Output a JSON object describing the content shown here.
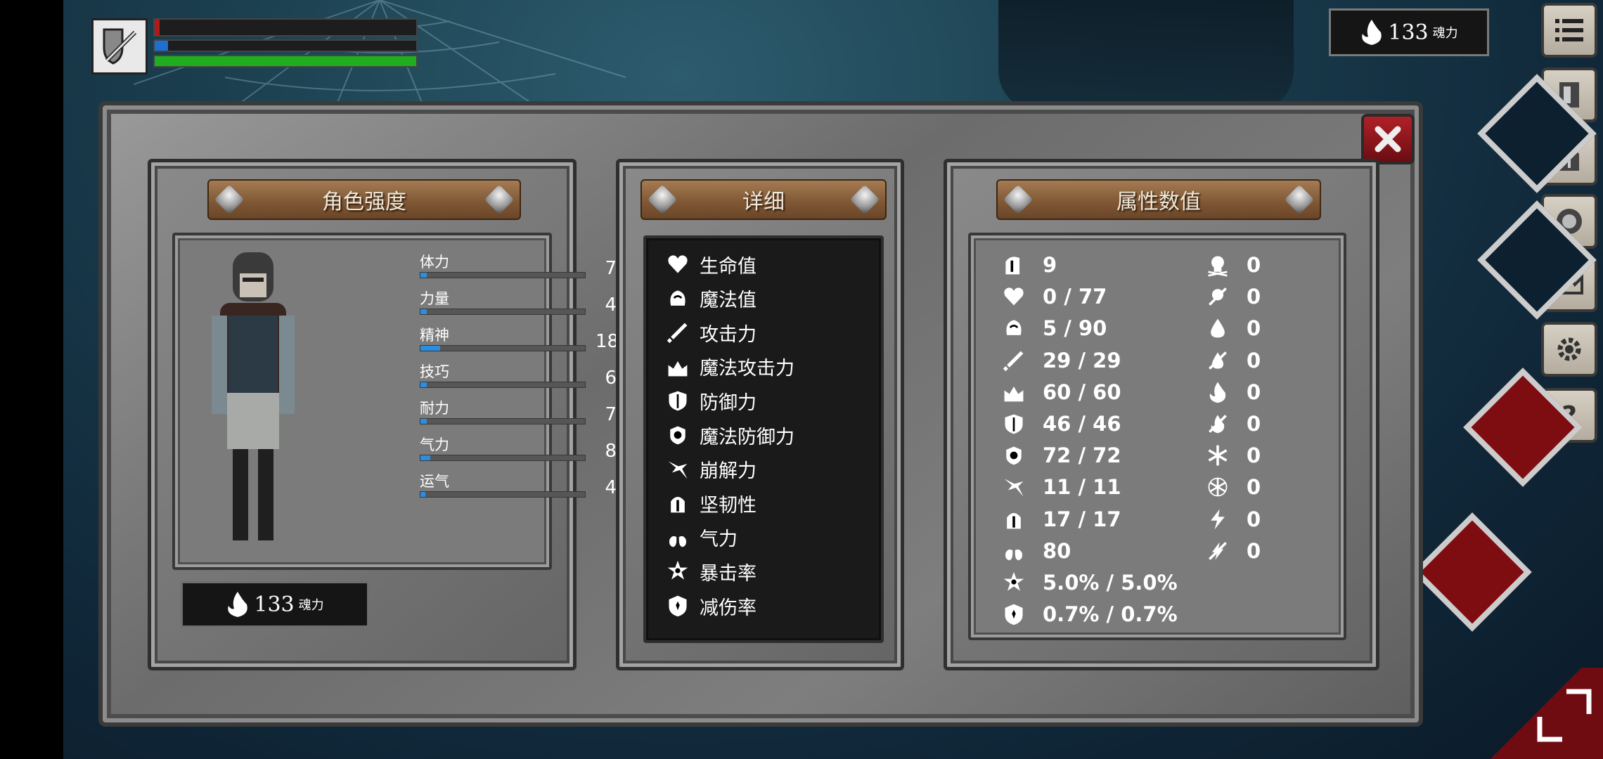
{
  "hud": {
    "soul_value": "133",
    "soul_label": "魂力"
  },
  "panels": {
    "character": {
      "title": "角色强度",
      "stats": [
        {
          "label": "体力",
          "value": "7",
          "fill": 0.04
        },
        {
          "label": "力量",
          "value": "4",
          "fill": 0.04
        },
        {
          "label": "精神",
          "value": "18",
          "fill": 0.12
        },
        {
          "label": "技巧",
          "value": "6",
          "fill": 0.04
        },
        {
          "label": "耐力",
          "value": "7",
          "fill": 0.04
        },
        {
          "label": "气力",
          "value": "8",
          "fill": 0.06
        },
        {
          "label": "运气",
          "value": "4",
          "fill": 0.03
        }
      ],
      "soul_value": "133",
      "soul_label": "魂力"
    },
    "detail": {
      "title": "详细",
      "items": [
        {
          "label": "生命值",
          "icon": "heart-icon"
        },
        {
          "label": "魔法值",
          "icon": "mana-head-icon"
        },
        {
          "label": "攻击力",
          "icon": "sword-icon"
        },
        {
          "label": "魔法攻击力",
          "icon": "magic-attack-icon"
        },
        {
          "label": "防御力",
          "icon": "shield-icon"
        },
        {
          "label": "魔法防御力",
          "icon": "magic-shield-icon"
        },
        {
          "label": "崩解力",
          "icon": "break-icon"
        },
        {
          "label": "坚韧性",
          "icon": "helmet-icon"
        },
        {
          "label": "气力",
          "icon": "lungs-icon"
        },
        {
          "label": "暴击率",
          "icon": "crit-star-icon"
        },
        {
          "label": "减伤率",
          "icon": "damage-reduce-icon"
        }
      ]
    },
    "attributes": {
      "title": "属性数值",
      "left": [
        {
          "value": "9",
          "icon": "helmet-side-icon"
        },
        {
          "value": "0 / 77",
          "icon": "heart-icon"
        },
        {
          "value": "5 / 90",
          "icon": "mana-head-icon"
        },
        {
          "value": "29 / 29",
          "icon": "sword-icon"
        },
        {
          "value": "60 / 60",
          "icon": "magic-attack-icon"
        },
        {
          "value": "46 / 46",
          "icon": "shield-icon"
        },
        {
          "value": "72 / 72",
          "icon": "magic-shield-icon"
        },
        {
          "value": "11 / 11",
          "icon": "break-icon"
        },
        {
          "value": "17 / 17",
          "icon": "helmet-icon"
        },
        {
          "value": "80",
          "icon": "lungs-icon"
        },
        {
          "value": "5.0% / 5.0%",
          "icon": "crit-star-icon"
        },
        {
          "value": "0.7% / 0.7%",
          "icon": "damage-reduce-icon"
        }
      ],
      "right": [
        {
          "value": "0",
          "icon": "skull-icon"
        },
        {
          "value": "0",
          "icon": "skull-resist-icon"
        },
        {
          "value": "0",
          "icon": "blood-drop-icon"
        },
        {
          "value": "0",
          "icon": "blood-resist-icon"
        },
        {
          "value": "0",
          "icon": "fire-icon"
        },
        {
          "value": "0",
          "icon": "fire-resist-icon"
        },
        {
          "value": "0",
          "icon": "frost-icon"
        },
        {
          "value": "0",
          "icon": "frost-resist-icon"
        },
        {
          "value": "0",
          "icon": "lightning-icon"
        },
        {
          "value": "0",
          "icon": "lightning-resist-icon"
        }
      ]
    }
  },
  "colors": {
    "accent_blue": "#2d8ee0",
    "health_red": "#b01a1a",
    "stamina_green": "#1fae1f",
    "mana_blue": "#1f6fd0",
    "close_red": "#9c1a20"
  }
}
